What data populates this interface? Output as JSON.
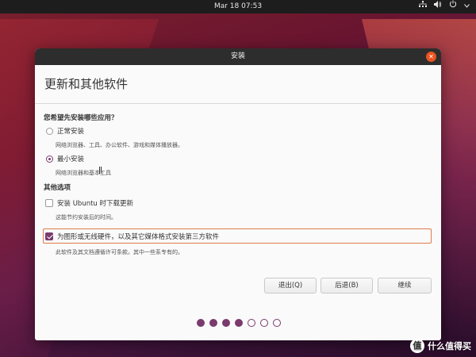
{
  "topbar": {
    "clock": "Mar 18  07:53",
    "network_icon": "network-icon",
    "volume_icon": "volume-icon",
    "power_icon": "power-icon"
  },
  "window": {
    "title": "安装",
    "close_icon": "close-icon"
  },
  "page": {
    "heading": "更新和其他软件"
  },
  "install_type": {
    "question": "您希望先安装哪些应用？",
    "options": [
      {
        "label": "正常安装",
        "description": "网络浏览器、工具、办公软件、游戏和媒体播放器。",
        "selected": false
      },
      {
        "label": "最小安装",
        "description": "网络浏览器和基本工具",
        "selected": true
      }
    ]
  },
  "other_options": {
    "title": "其他选项",
    "download_updates": {
      "label": "安装 Ubuntu 时下载更新",
      "description": "这能节约安装后的时间。",
      "checked": false
    },
    "third_party": {
      "label": "为图形或无线硬件，以及其它媒体格式安装第三方软件",
      "description": "此软件及其文档遵循许可条款。其中一些系专有的。",
      "checked": true
    }
  },
  "buttons": {
    "quit": "退出(Q)",
    "back": "后退(B)",
    "continue": "继续"
  },
  "progress": {
    "total_steps": 7,
    "completed_steps": 4
  },
  "watermark": {
    "badge": "值",
    "text": "什么值得买"
  },
  "colors": {
    "accent": "#7a3a6e",
    "close_button": "#e95420",
    "highlight_border": "#e07a4a",
    "titlebar": "#2d2d2d"
  }
}
